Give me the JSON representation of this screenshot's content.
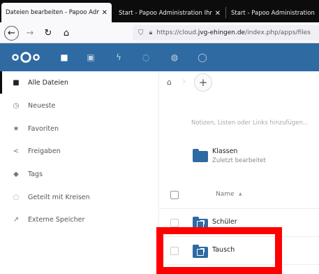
{
  "browser": {
    "tabs": [
      {
        "title": "Dateien bearbeiten - Papoo Admi",
        "active": true
      },
      {
        "title": "Start - Papoo Administration Ihre",
        "active": false
      },
      {
        "title": "Start - Papoo Administration Ihre",
        "active": false
      }
    ],
    "tab_close": "✕",
    "url": {
      "prefix": "https://cloud.",
      "host": "jvg-ehingen.de",
      "path": "/index.php/apps/files"
    }
  },
  "header": {
    "apps": [
      {
        "icon": "folder-icon",
        "glyph": "■"
      },
      {
        "icon": "image-icon",
        "glyph": "▣"
      },
      {
        "icon": "activity-icon",
        "glyph": "ϟ"
      },
      {
        "icon": "circles-icon",
        "glyph": "◌"
      },
      {
        "icon": "globe-icon",
        "glyph": "◍"
      },
      {
        "icon": "talk-icon",
        "glyph": "◯"
      }
    ]
  },
  "sidebar": {
    "items": [
      {
        "label": "Alle Dateien",
        "icon": "folder-icon",
        "glyph": "■",
        "active": true
      },
      {
        "label": "Neueste",
        "icon": "clock-icon",
        "glyph": "◷",
        "active": false
      },
      {
        "label": "Favoriten",
        "icon": "star-icon",
        "glyph": "★",
        "active": false
      },
      {
        "label": "Freigaben",
        "icon": "share-icon",
        "glyph": "<",
        "active": false
      },
      {
        "label": "Tags",
        "icon": "tag-icon",
        "glyph": "◆",
        "active": false
      },
      {
        "label": "Geteilt mit Kreisen",
        "icon": "circles-icon",
        "glyph": "◌",
        "active": false
      },
      {
        "label": "Externe Speicher",
        "icon": "external-icon",
        "glyph": "↗",
        "active": false
      }
    ]
  },
  "main": {
    "notes_placeholder": "Notizen, Listen oder Links hinzufügen...",
    "recent": {
      "name": "Klassen",
      "subtitle": "Zuletzt bearbeitet"
    },
    "column_name": "Name",
    "sort_indicator": "▲",
    "files": [
      {
        "name": "Schüler",
        "shared": true
      },
      {
        "name": "Tausch",
        "shared": true
      }
    ]
  },
  "colors": {
    "nextcloud_blue": "#2f6aa2",
    "highlight_red": "#ff0000"
  }
}
